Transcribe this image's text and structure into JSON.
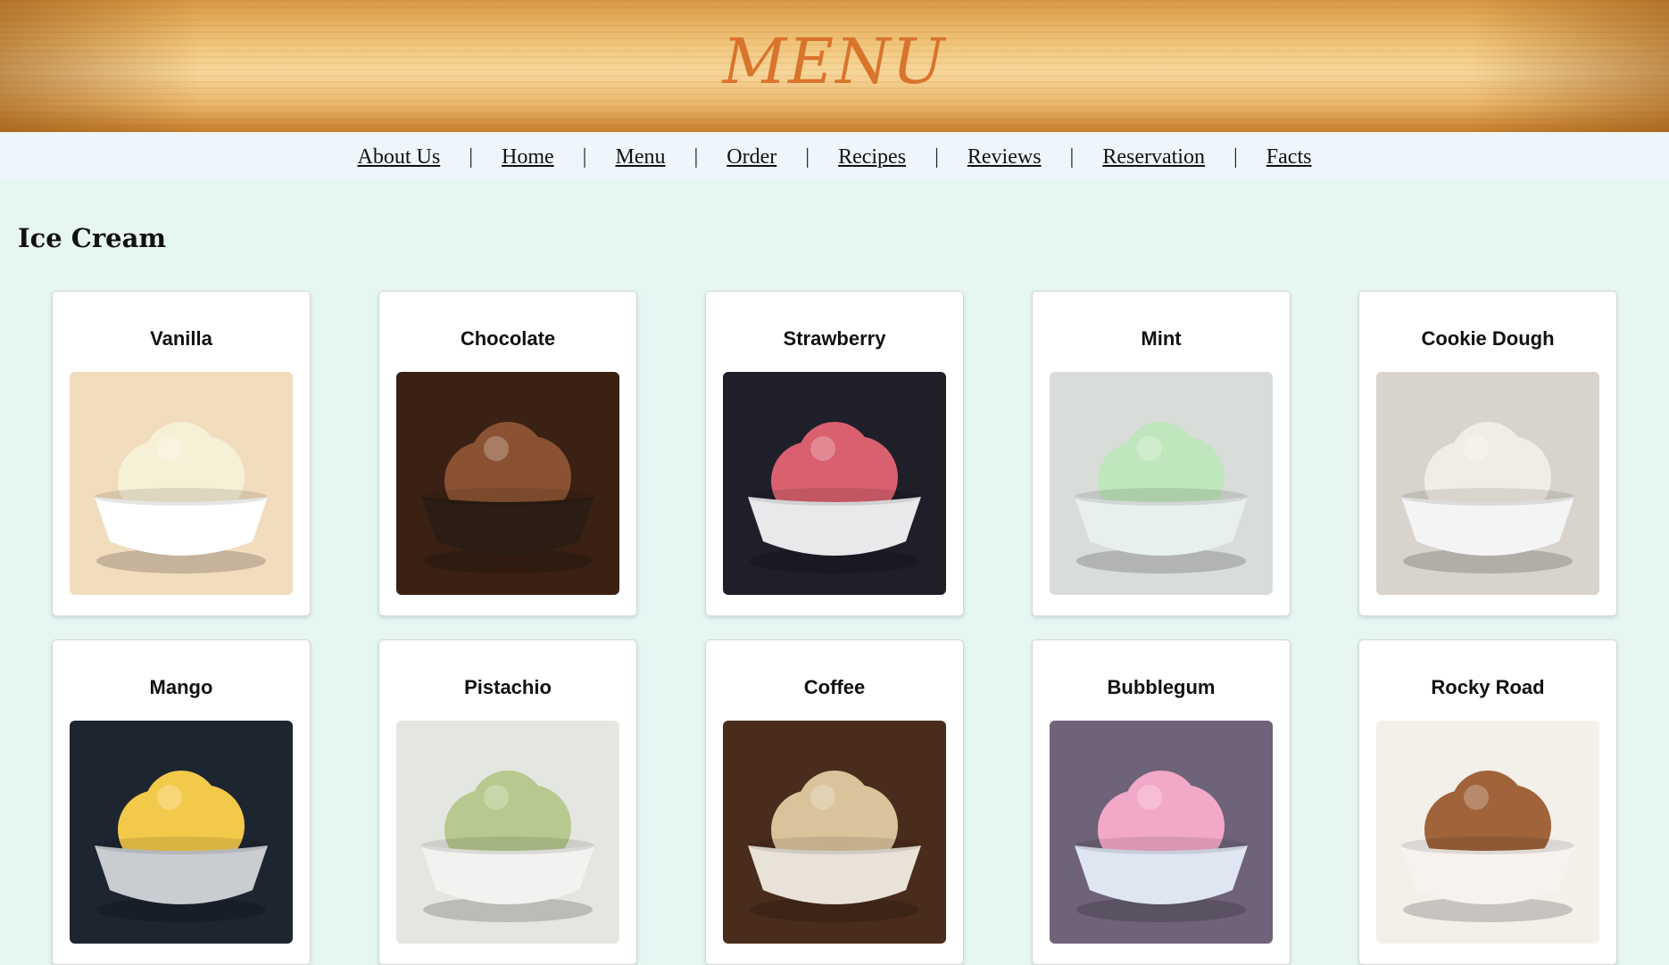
{
  "header": {
    "title": "MENU"
  },
  "nav": {
    "items": [
      "About Us",
      "Home",
      "Menu",
      "Order",
      "Recipes",
      "Reviews",
      "Reservation",
      "Facts"
    ],
    "separator": "|"
  },
  "section": {
    "title": "Ice Cream"
  },
  "flavors": [
    {
      "name": "Vanilla",
      "image": "vanilla-ice-cream-image",
      "bg": "#f1dcbd",
      "scoop": "#f6f0d6",
      "bowl": "#ffffff"
    },
    {
      "name": "Chocolate",
      "image": "chocolate-ice-cream-image",
      "bg": "#3a2114",
      "scoop": "#8a5232",
      "bowl": "#2b1d14"
    },
    {
      "name": "Strawberry",
      "image": "strawberry-ice-cream-image",
      "bg": "#1f1f2a",
      "scoop": "#d9606f",
      "bowl": "#e9e9ec"
    },
    {
      "name": "Mint",
      "image": "mint-ice-cream-image",
      "bg": "#d9ddd9",
      "scoop": "#bfe6bd",
      "bowl": "#e8f0ee"
    },
    {
      "name": "Cookie Dough",
      "image": "cookie-dough-ice-cream-image",
      "bg": "#d8d3cc",
      "scoop": "#f2ede4",
      "bowl": "#f4f4f4"
    },
    {
      "name": "Mango",
      "image": "mango-ice-cream-image",
      "bg": "#1d2530",
      "scoop": "#f3c94a",
      "bowl": "#c9ccd0"
    },
    {
      "name": "Pistachio",
      "image": "pistachio-ice-cream-image",
      "bg": "#e4e6e1",
      "scoop": "#b7c98e",
      "bowl": "#f2f2f0"
    },
    {
      "name": "Coffee",
      "image": "coffee-ice-cream-image",
      "bg": "#4a2c1c",
      "scoop": "#d9c39b",
      "bowl": "#e8e2d8"
    },
    {
      "name": "Bubblegum",
      "image": "bubblegum-ice-cream-image",
      "bg": "#6e6378",
      "scoop": "#f2a9c8",
      "bowl": "#dfe6f2"
    },
    {
      "name": "Rocky Road",
      "image": "rocky-road-ice-cream-image",
      "bg": "#f3efe9",
      "scoop": "#a0633a",
      "bowl": "#f6f3ee"
    }
  ]
}
